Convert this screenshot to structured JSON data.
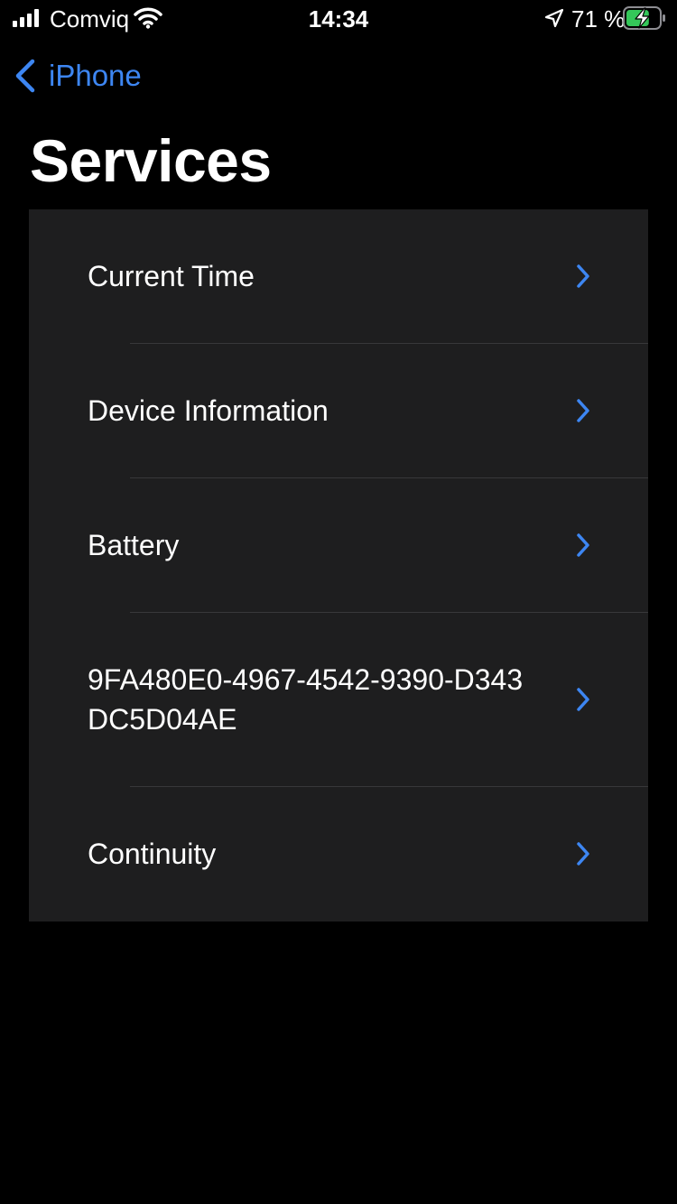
{
  "status_bar": {
    "carrier": "Comviq",
    "time": "14:34",
    "battery_percent": "71 %",
    "battery_level": 0.71,
    "charging": true,
    "icons": [
      "signal-icon",
      "wifi-icon",
      "location-icon",
      "battery-charging-icon"
    ]
  },
  "nav": {
    "back_label": "iPhone",
    "back_icon": "chevron-left-icon"
  },
  "page": {
    "title": "Services"
  },
  "services": {
    "items": [
      {
        "label": "Current Time"
      },
      {
        "label": "Device Information"
      },
      {
        "label": "Battery"
      },
      {
        "label": "9FA480E0-4967-4542-9390-D343DC5D04AE"
      },
      {
        "label": "Continuity"
      }
    ],
    "row_icon": "chevron-right-icon"
  },
  "colors": {
    "background": "#000000",
    "list_background": "#1e1e1f",
    "accent": "#3d86f2",
    "separator": "#38383a",
    "battery_charging": "#34c759"
  }
}
